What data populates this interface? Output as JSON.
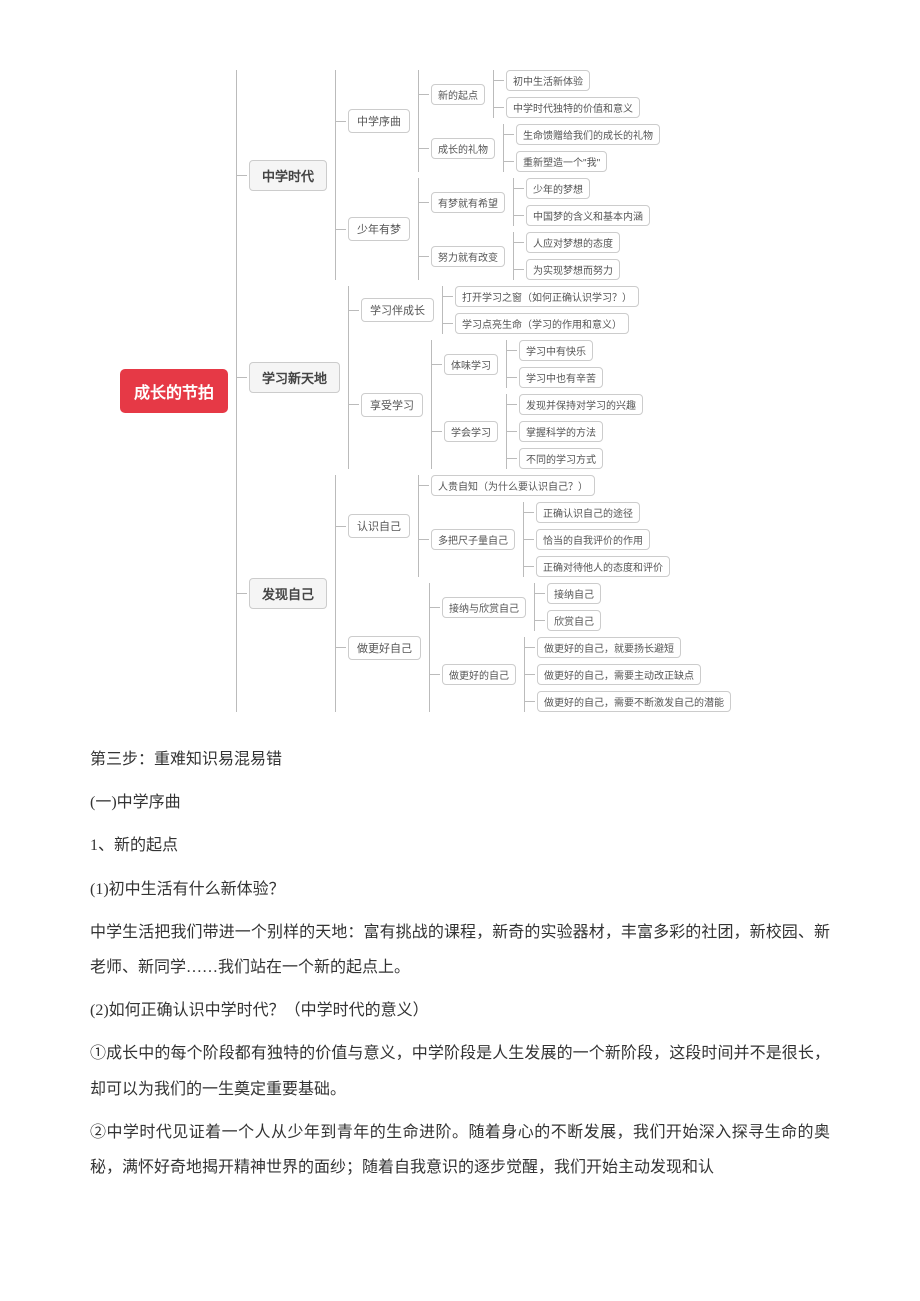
{
  "mindmap": {
    "root": "成长的节拍",
    "b1": {
      "title": "中学时代",
      "c1": {
        "title": "中学序曲",
        "d1": {
          "title": "新的起点",
          "e1": "初中生活新体验",
          "e2": "中学时代独特的价值和意义"
        },
        "d2": {
          "title": "成长的礼物",
          "e1": "生命馈赠给我们的成长的礼物",
          "e2": "重新塑造一个\"我\""
        }
      },
      "c2": {
        "title": "少年有梦",
        "d1": {
          "title": "有梦就有希望",
          "e1": "少年的梦想",
          "e2": "中国梦的含义和基本内涵"
        },
        "d2": {
          "title": "努力就有改变",
          "e1": "人应对梦想的态度",
          "e2": "为实现梦想而努力"
        }
      }
    },
    "b2": {
      "title": "学习新天地",
      "c1": {
        "title": "学习伴成长",
        "d1": "打开学习之窗（如何正确认识学习？）",
        "d2": "学习点亮生命（学习的作用和意义）"
      },
      "c2": {
        "title": "享受学习",
        "d1": {
          "title": "体味学习",
          "e1": "学习中有快乐",
          "e2": "学习中也有辛苦"
        },
        "d2": {
          "title": "学会学习",
          "e1": "发现并保持对学习的兴趣",
          "e2": "掌握科学的方法",
          "e3": "不同的学习方式"
        }
      }
    },
    "b3": {
      "title": "发现自己",
      "c1": {
        "title": "认识自己",
        "d1": "人贵自知（为什么要认识自己？）",
        "d2": {
          "title": "多把尺子量自己",
          "e1": "正确认识自己的途径",
          "e2": "恰当的自我评价的作用",
          "e3": "正确对待他人的态度和评价"
        }
      },
      "c2": {
        "title": "做更好自己",
        "d1": {
          "title": "接纳与欣赏自己",
          "e1": "接纳自己",
          "e2": "欣赏自己"
        },
        "d2": {
          "title": "做更好的自己",
          "e1": "做更好的自己，就要扬长避短",
          "e2": "做更好的自己，需要主动改正缺点",
          "e3": "做更好的自己，需要不断激发自己的潜能"
        }
      }
    }
  },
  "text": {
    "step3": "第三步：重难知识易混易错",
    "s1": "(一)中学序曲",
    "h1": "1、新的起点",
    "q1": "(1)初中生活有什么新体验？",
    "p1": "中学生活把我们带进一个别样的天地：富有挑战的课程，新奇的实验器材，丰富多彩的社团，新校园、新老师、新同学……我们站在一个新的起点上。",
    "q2": "(2)如何正确认识中学时代？（中学时代的意义）",
    "p2": "①成长中的每个阶段都有独特的价值与意义，中学阶段是人生发展的一个新阶段，这段时间并不是很长，却可以为我们的一生奠定重要基础。",
    "p3": "②中学时代见证着一个人从少年到青年的生命进阶。随着身心的不断发展，我们开始深入探寻生命的奥秘，满怀好奇地揭开精神世界的面纱；随着自我意识的逐步觉醒，我们开始主动发现和认"
  }
}
